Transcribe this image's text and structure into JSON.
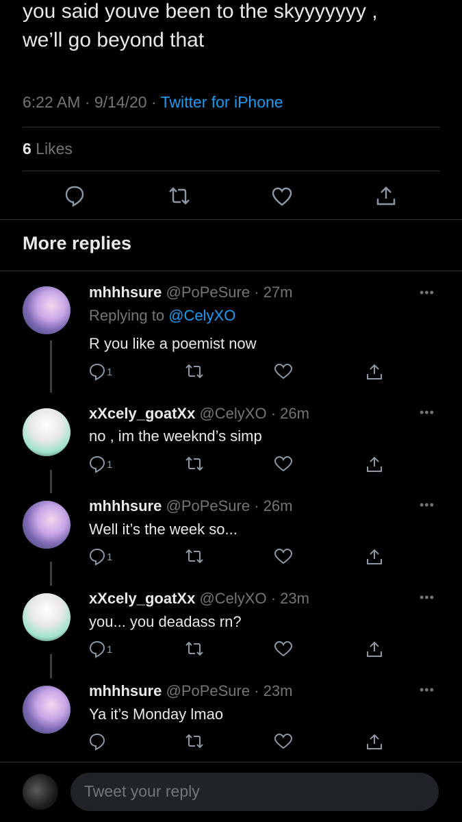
{
  "tweet": {
    "text_line1": "you said youve been to the skyyyyyyy ,",
    "text_line2": "we’ll go beyond that",
    "time": "6:22 AM",
    "date": "9/14/20",
    "source": "Twitter for iPhone",
    "likes_count": "6",
    "likes_label": "Likes"
  },
  "section_title": "More replies",
  "replies": [
    {
      "name": "mhhhsure",
      "handle": "@PoPeSure",
      "time": "27m",
      "replying_prefix": "Replying to",
      "replying_to": "@CelyXO",
      "text": "R you like a poemist now",
      "reply_count": "1",
      "more": "•••"
    },
    {
      "name": "xXcely_goatXx",
      "handle": "@CelyXO",
      "time": "26m",
      "text": "no , im the weeknd’s simp",
      "reply_count": "1",
      "more": "•••"
    },
    {
      "name": "mhhhsure",
      "handle": "@PoPeSure",
      "time": "26m",
      "text": "Well it’s the week so...",
      "reply_count": "1",
      "more": "•••"
    },
    {
      "name": "xXcely_goatXx",
      "handle": "@CelyXO",
      "time": "23m",
      "text": "you... you deadass rn?",
      "reply_count": "1",
      "more": "•••"
    },
    {
      "name": "mhhhsure",
      "handle": "@PoPeSure",
      "time": "23m",
      "text": "Ya it’s Monday lmao",
      "reply_count": "",
      "more": "•••"
    }
  ],
  "compose": {
    "placeholder": "Tweet your reply"
  },
  "icons": [
    "reply-icon",
    "retweet-icon",
    "like-icon",
    "share-icon",
    "more-icon"
  ],
  "colors": {
    "background": "#000000",
    "accent": "#1d9bf0",
    "muted": "#71767b",
    "text": "#e7e9ea"
  }
}
